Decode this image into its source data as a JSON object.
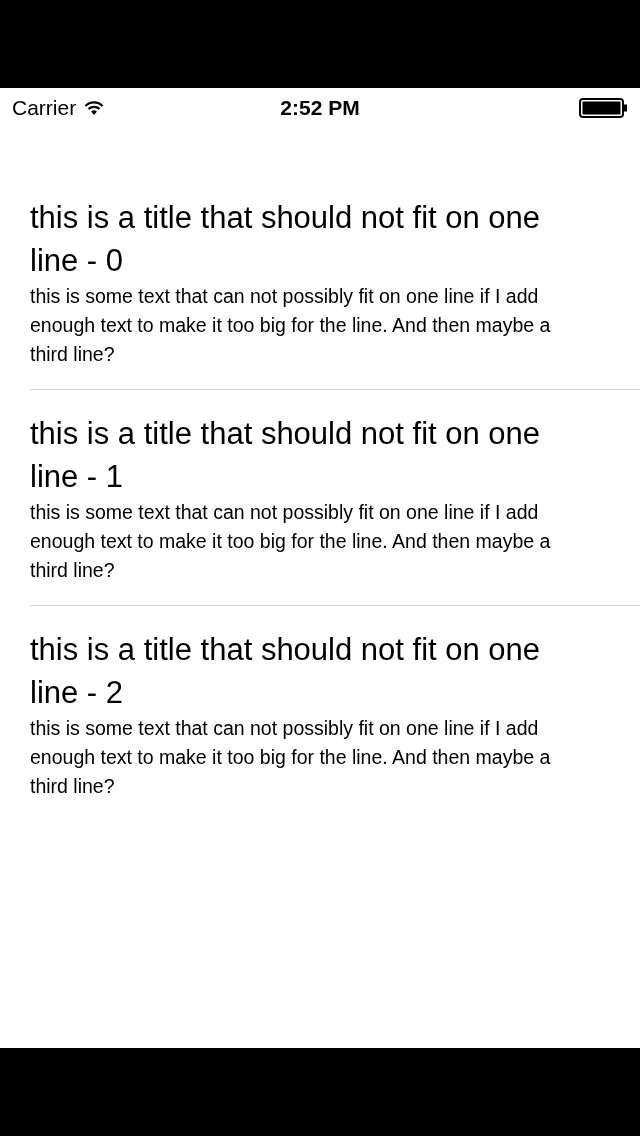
{
  "status_bar": {
    "carrier": "Carrier",
    "time": "2:52 PM"
  },
  "items": [
    {
      "title": "this is a title that should not fit on one line - 0",
      "text": "this is some text that can not possibly fit on one line if I add enough text to make it too big for the line. And then maybe a third line?"
    },
    {
      "title": "this is a title that should not fit on one line - 1",
      "text": "this is some text that can not possibly fit on one line if I add enough text to make it too big for the line. And then maybe a third line?"
    },
    {
      "title": "this is a title that should not fit on one line - 2",
      "text": "this is some text that can not possibly fit on one line if I add enough text to make it too big for the line. And then maybe a third line?"
    }
  ]
}
